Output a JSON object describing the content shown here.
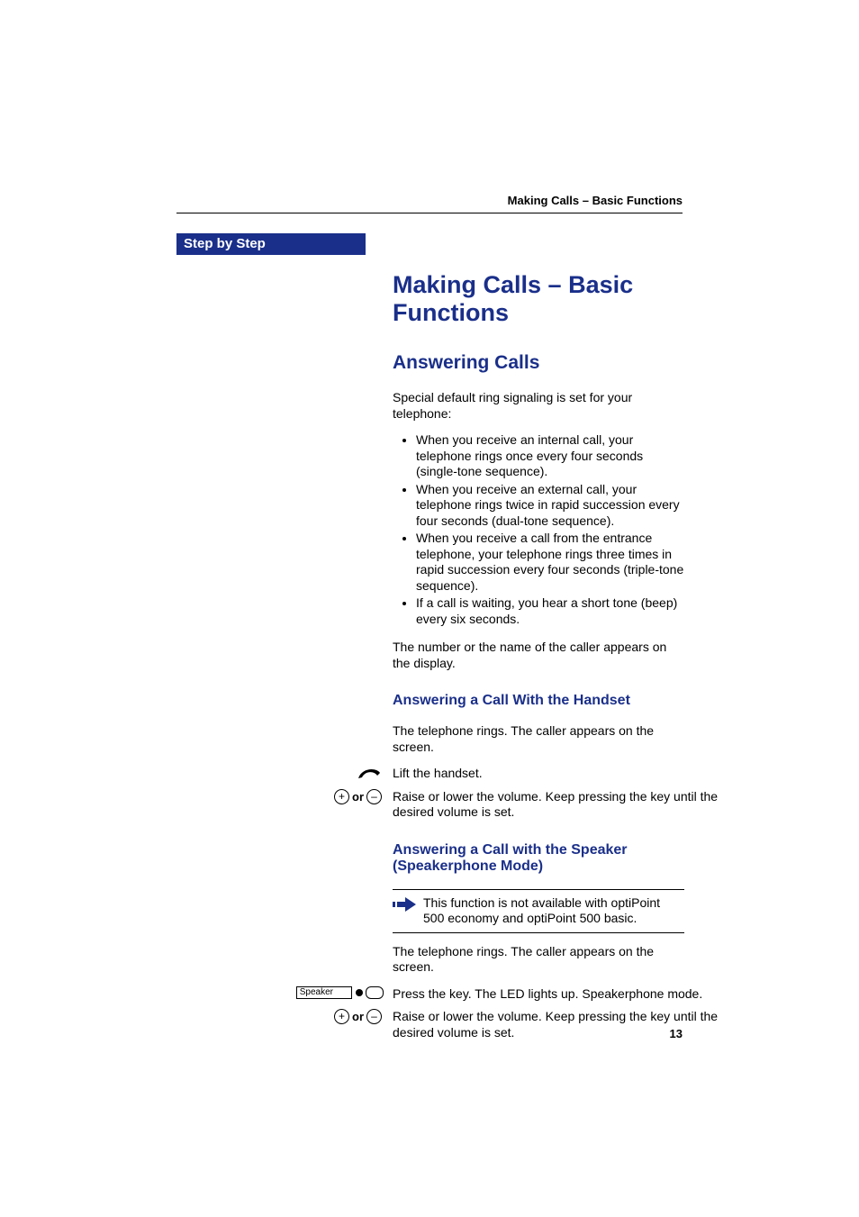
{
  "running_head": "Making Calls – Basic Functions",
  "sidebar_tab": "Step by Step",
  "page_number": "13",
  "headings": {
    "h1": "Making Calls – Basic Functions",
    "h2_answering": "Answering Calls",
    "h3_handset": "Answering a Call With the Handset",
    "h3_speaker": "Answering a Call with the Speaker (Speakerphone Mode)"
  },
  "text": {
    "intro": "Special default ring signaling is set for your telephone:",
    "bullets": {
      "b1": "When you receive an internal call, your telephone rings once every four seconds (single-tone sequence).",
      "b2": "When you receive an external call, your telephone rings twice in rapid succession every four seconds (dual-tone sequence).",
      "b3": "When you receive a call from the entrance telephone, your telephone rings three times in rapid succession every four seconds (triple-tone sequence).",
      "b4": "If a call is waiting, you hear a short tone (beep) every six seconds."
    },
    "after_bullets": "The number or the name of the caller appears on the display.",
    "handset_intro": "The telephone rings. The caller appears on the screen.",
    "lift_handset": "Lift the handset.",
    "volume": "Raise or lower the volume. Keep pressing the key until the desired volume is set.",
    "speaker_note": "This function is not available with optiPoint 500 economy and optiPoint 500 basic.",
    "speaker_intro": "The telephone rings. The caller appears on the screen.",
    "press_key": "Press the key. The LED lights up. Speakerphone mode."
  },
  "labels": {
    "or": "or",
    "plus": "+",
    "minus": "–",
    "speaker_key": "Speaker"
  }
}
